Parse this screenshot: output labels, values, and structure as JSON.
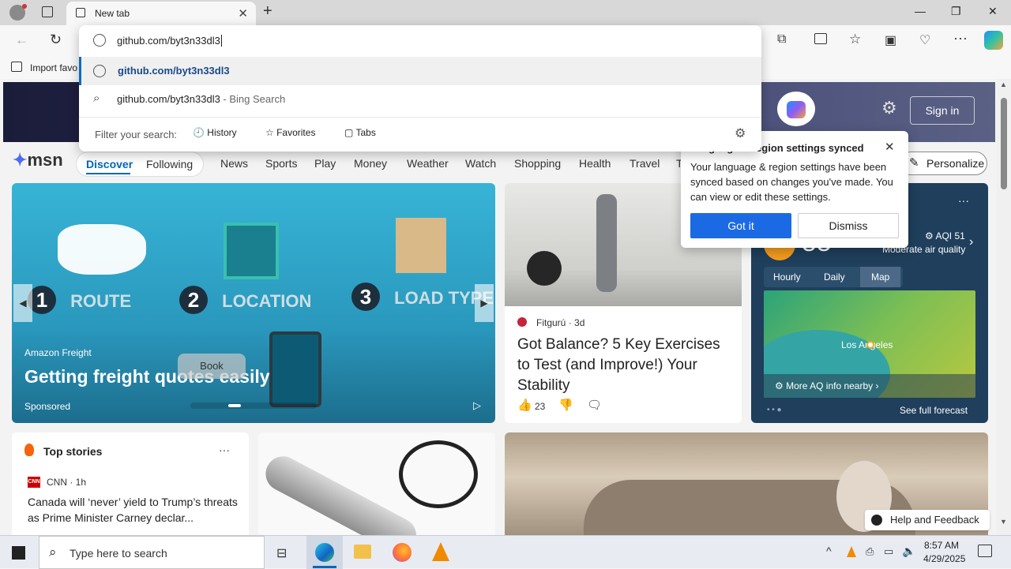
{
  "browser": {
    "tab_title": "New tab",
    "favorites_bar": {
      "import_label": "Import favo"
    },
    "omnibox": {
      "value": "github.com/byt3n33dl3",
      "suggestions": [
        {
          "text": "github.com/byt3n33dl3",
          "suffix": ""
        },
        {
          "text": "github.com/byt3n33dl3",
          "suffix": " - Bing Search"
        }
      ],
      "filter_label": "Filter your search:",
      "filters": [
        "History",
        "Favorites",
        "Tabs"
      ]
    }
  },
  "msn": {
    "logo": "msn",
    "signin": "Sign in",
    "tabs": [
      "Discover",
      "Following"
    ],
    "nav": [
      "News",
      "Sports",
      "Play",
      "Money",
      "Weather",
      "Watch",
      "Shopping",
      "Health",
      "Travel",
      "T"
    ],
    "personalize": "Personalize",
    "ad": {
      "steps": [
        {
          "num": "1",
          "label": "ROUTE"
        },
        {
          "num": "2",
          "label": "LOCATION"
        },
        {
          "num": "3",
          "label": "LOAD TYPE"
        }
      ],
      "source": "Amazon Freight",
      "title": "Getting freight quotes easily",
      "cta": "Book",
      "sponsored": "Sponsored"
    },
    "article": {
      "source": "Fitgurú",
      "age": "3d",
      "title": "Got Balance? 5 Key Exercises to Test (and Improve!) Your Stability",
      "likes": "23"
    },
    "weather": {
      "temp": "55",
      "aqi": "AQI 51",
      "aqi_text": "Moderate air quality",
      "tabs": [
        "Hourly",
        "Daily",
        "Map"
      ],
      "map_label": "Los Angeles",
      "more_aq": "More AQ info nearby",
      "forecast": "See full forecast"
    },
    "top_stories": {
      "title": "Top stories",
      "source": "CNN",
      "age": "1h",
      "headline": "Canada will ‘never’ yield to Trump’s threats as Prime Minister Carney declar..."
    },
    "help": "Help and Feedback"
  },
  "popup": {
    "title": "Language & region settings synced",
    "body": "Your language & region settings have been synced based on changes you've made. You can view or edit these settings.",
    "got_it": "Got it",
    "dismiss": "Dismiss"
  },
  "taskbar": {
    "search_placeholder": "Type here to search",
    "time": "8:57 AM",
    "date": "4/29/2025"
  },
  "colors": {
    "accent": "#0067c0",
    "msn_blue": "#0067b8",
    "popup_button": "#1b6ae4"
  }
}
